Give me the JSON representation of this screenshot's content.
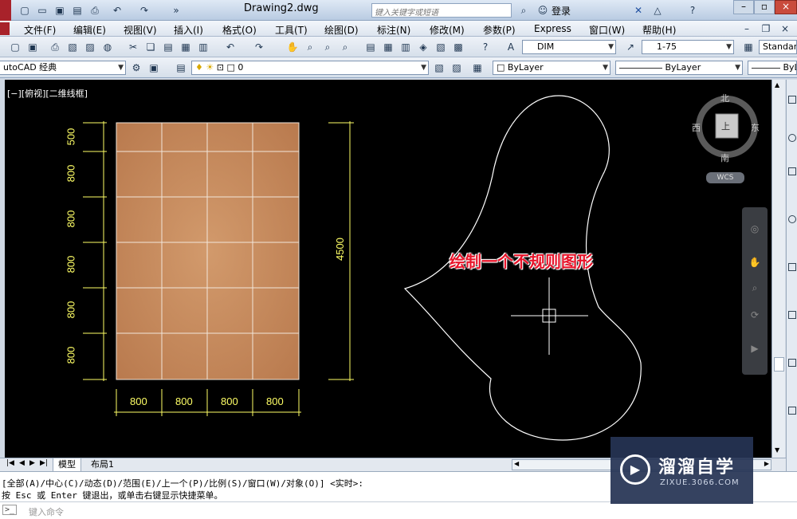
{
  "title": {
    "doc": "Drawing2.dwg",
    "search_placeholder": "键入关键字或短语",
    "login": "登录"
  },
  "menu": [
    "文件(F)",
    "编辑(E)",
    "视图(V)",
    "插入(I)",
    "格式(O)",
    "工具(T)",
    "绘图(D)",
    "标注(N)",
    "修改(M)",
    "参数(P)",
    "Express",
    "窗口(W)",
    "帮助(H)"
  ],
  "toolbar1": {
    "dimstyle": "DIM",
    "scale": "1-75",
    "textstyle": "Standar"
  },
  "toolbar2": {
    "workspace": "utoCAD 经典",
    "layer": "0",
    "color": "ByLayer",
    "linetype": "ByLayer",
    "lineweight": "ByL"
  },
  "viewport": {
    "label": "[−][俯视][二维线框]",
    "annotation": "绘制一个不规则图形"
  },
  "viewcube": {
    "north": "北",
    "south": "南",
    "east": "东",
    "west": "西",
    "top": "上",
    "wcs": "WCS"
  },
  "dimensions": {
    "left": [
      "500",
      "800",
      "800",
      "800",
      "800",
      "800"
    ],
    "bottom": [
      "800",
      "800",
      "800",
      "800"
    ],
    "right": "4500"
  },
  "tabs": [
    "模型",
    "布局1"
  ],
  "command": {
    "line1": "[全部(A)/中心(C)/动态(D)/范围(E)/上一个(P)/比例(S)/窗口(W)/对象(O)] <实时>:",
    "line2": "按 Esc 或 Enter 键退出，或单击右键显示快捷菜单。",
    "prompt": "键入命令"
  },
  "watermark": {
    "name": "溜溜自学",
    "url": "ZIXUE.3066.COM"
  },
  "colors": {
    "dim": "#ffff66",
    "annotation": "#e8142a",
    "tile": "#c8885c",
    "canvas": "#000000"
  }
}
